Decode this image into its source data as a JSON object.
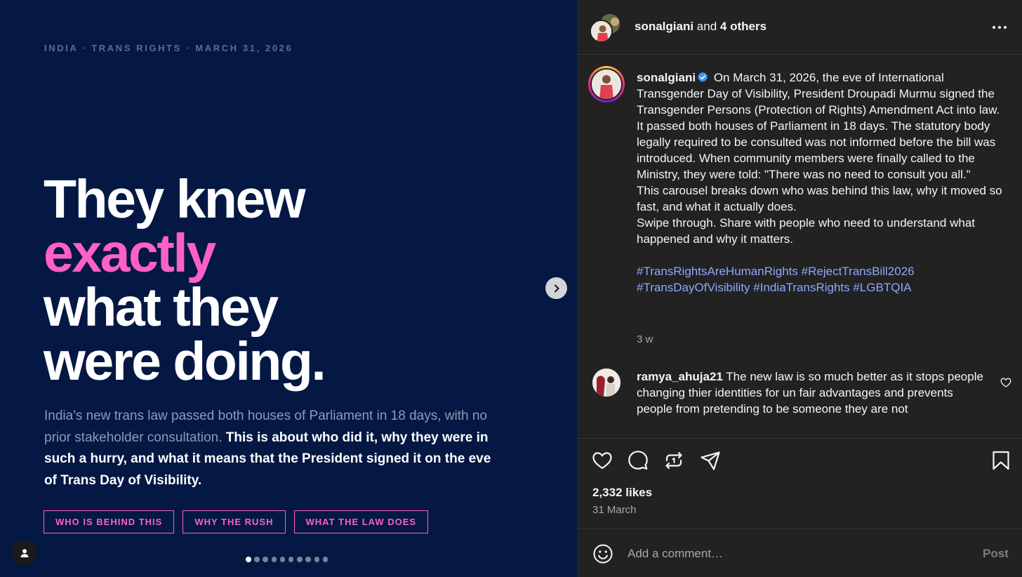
{
  "slide": {
    "kicker": "INDIA · TRANS RIGHTS · MARCH 31, 2026",
    "headline": {
      "line1": "They knew",
      "line2": "exactly",
      "line3": "what they",
      "line4": "were doing."
    },
    "body_regular": "India's new trans law passed both houses of Parliament in 18 days, with no prior stakeholder consultation. ",
    "body_bold": "This is about who did it, why they were in such a hurry, and what it means that the President signed it on the eve of Trans Day of Visibility.",
    "tags": [
      "WHO IS BEHIND THIS",
      "WHY THE RUSH",
      "WHAT THE LAW DOES"
    ],
    "pagination": {
      "current": 1,
      "total": 10
    },
    "colors": {
      "background": "#041843",
      "accent": "#ff5fc8"
    }
  },
  "header": {
    "username": "sonalgiani",
    "connector": " and ",
    "others": "4 others"
  },
  "post": {
    "username": "sonalgiani",
    "caption_lines": [
      "On March 31, 2026, the eve of International Transgender Day of Visibility, President Droupadi Murmu signed the Transgender Persons (Protection of Rights) Amendment Act into law.",
      "It passed both houses of Parliament in 18 days. The statutory body legally required to be consulted was not informed before the bill was introduced. When community members were finally called to the Ministry, they were told: \"There was no need to consult you all.\"",
      "This carousel breaks down who was behind this law, why it moved so fast, and what it actually does.",
      "Swipe through. Share with people who need to understand what happened and why it matters."
    ],
    "hashtags": [
      "#TransRightsAreHumanRights",
      "#RejectTransBill2026",
      "#TransDayOfVisibility",
      "#IndiaTransRights",
      "#LGBTQIA"
    ],
    "time_ago": "3 w",
    "likes": "2,332 likes",
    "date": "31 March"
  },
  "comment": {
    "username": "ramya_ahuja21",
    "text": "The new law is so much better as it stops people changing thier identities for un fair advantages and prevents people from pretending to be someone they are not"
  },
  "comment_bar": {
    "placeholder": "Add a comment…",
    "post_label": "Post"
  },
  "icons": {
    "header": [
      "more-options-icon"
    ],
    "actions": [
      "heart-icon",
      "comment-icon",
      "repost-icon",
      "share-icon",
      "bookmark-icon"
    ],
    "slide": [
      "chevron-right-icon",
      "user-tag-icon"
    ],
    "caption": [
      "verified-badge-icon"
    ],
    "comment": [
      "small-heart-icon"
    ],
    "comment_bar": [
      "emoji-icon"
    ]
  }
}
